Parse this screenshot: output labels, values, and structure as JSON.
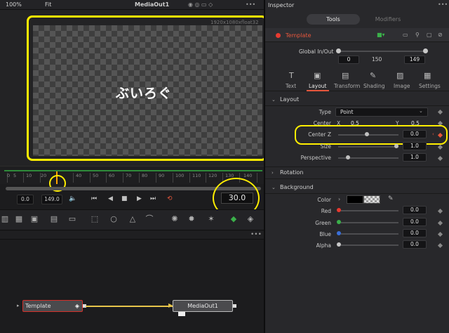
{
  "viewer": {
    "zoom": "100%",
    "fit": "Fit",
    "title": "MediaOut1",
    "resolution": "1920x1080xfloat32",
    "overlay_text": "ぶいろぐ"
  },
  "ruler": {
    "labels": [
      "0",
      "5",
      "10",
      "20",
      "40",
      "50",
      "60",
      "70",
      "80",
      "90",
      "100",
      "110",
      "120",
      "130",
      "140"
    ]
  },
  "transport": {
    "start_time": "0.0",
    "end_time": "149.0",
    "fps": "30.0"
  },
  "nodes": {
    "template": "Template",
    "media_out": "MediaOut1"
  },
  "inspector": {
    "title": "Inspector",
    "tabs_top": {
      "tools": "Tools",
      "modifiers": "Modifiers"
    },
    "tool_name": "Template",
    "global_in_out": {
      "label": "Global In/Out",
      "start": "0",
      "mid": "150",
      "end": "149"
    },
    "tabs": [
      "Text",
      "Layout",
      "Transform",
      "Shading",
      "Image",
      "Settings"
    ],
    "sections": {
      "layout": "Layout",
      "rotation": "Rotation",
      "background": "Background"
    },
    "layout": {
      "type_label": "Type",
      "type_value": "Point",
      "center_label": "Center",
      "x_label": "X",
      "x_value": "0.5",
      "y_label": "Y",
      "y_value": "0.5",
      "centerz_label": "Center Z",
      "centerz_value": "0.0",
      "size_label": "Size",
      "size_value": "1.0",
      "perspective_label": "Perspective",
      "perspective_value": "1.0"
    },
    "background": {
      "color_label": "Color",
      "red_label": "Red",
      "red_value": "0.0",
      "green_label": "Green",
      "green_value": "0.0",
      "blue_label": "Blue",
      "blue_value": "0.0",
      "alpha_label": "Alpha",
      "alpha_value": "0.0"
    }
  },
  "colors": {
    "accent": "#e6563c",
    "highlight": "#ffee00",
    "red_channel": "#e83a30",
    "green_channel": "#3bb04a",
    "blue_channel": "#3a6fd8",
    "alpha_channel": "#c8c8c8"
  }
}
